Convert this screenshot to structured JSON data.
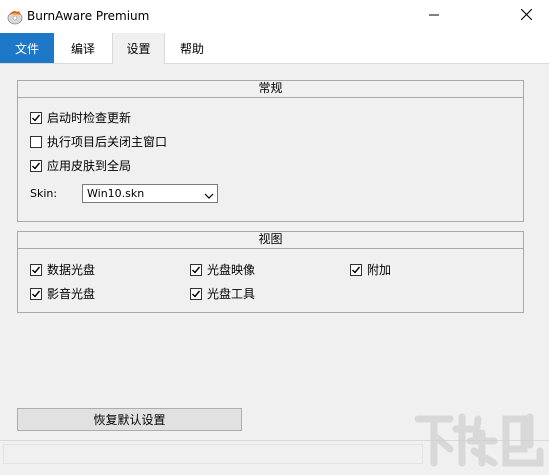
{
  "window": {
    "title": "BurnAware Premium",
    "icon": "burnaware-flame-icon",
    "minimize_icon": "minimize-icon",
    "close_icon": "close-icon"
  },
  "tabs": [
    {
      "label": "文件",
      "active": false
    },
    {
      "label": "编译",
      "active": false
    },
    {
      "label": "设置",
      "active": true
    },
    {
      "label": "帮助",
      "active": false
    }
  ],
  "general": {
    "title": "常规",
    "options": [
      {
        "label": "启动时检查更新",
        "checked": true
      },
      {
        "label": "执行项目后关闭主窗口",
        "checked": false
      },
      {
        "label": "应用皮肤到全局",
        "checked": true
      }
    ],
    "skin_label": "Skin:",
    "skin_value": "Win10.skn"
  },
  "view": {
    "title": "视图",
    "options": [
      {
        "label": "数据光盘",
        "checked": true
      },
      {
        "label": "光盘映像",
        "checked": true
      },
      {
        "label": "附加",
        "checked": true
      },
      {
        "label": "影音光盘",
        "checked": true
      },
      {
        "label": "光盘工具",
        "checked": true
      }
    ]
  },
  "restore_button": "恢复默认设置",
  "colors": {
    "accent": "#1e78c8",
    "background": "#f0f0f0",
    "border": "#a9a9a9"
  }
}
